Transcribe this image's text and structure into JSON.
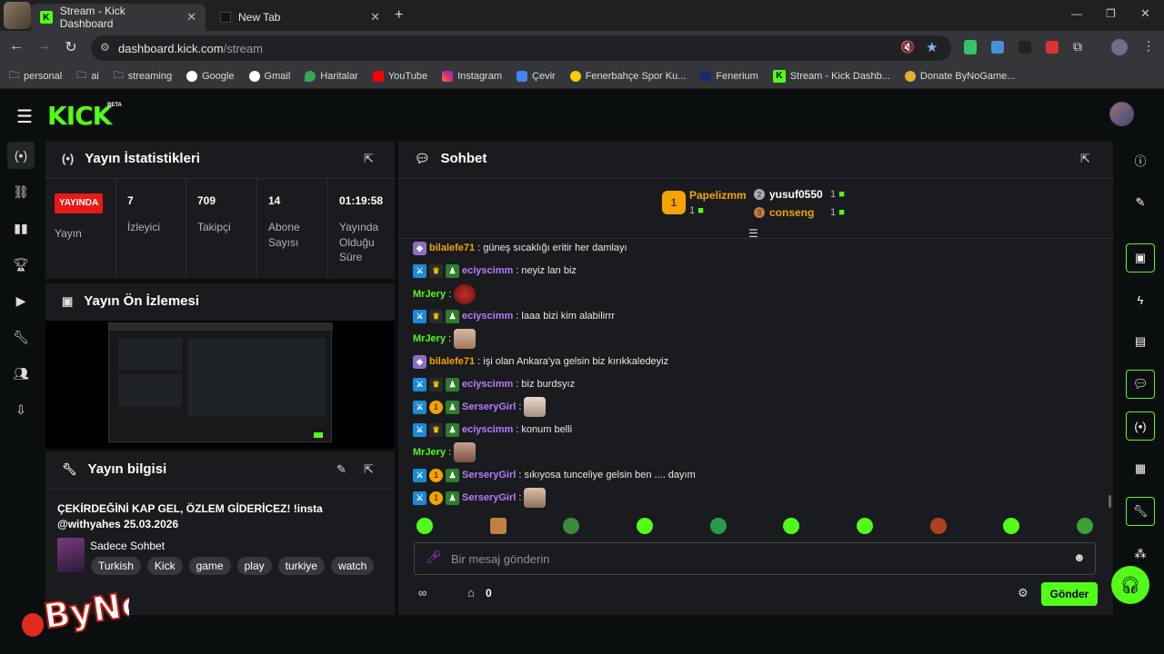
{
  "browser": {
    "tabs": [
      {
        "title": "Stream - Kick Dashboard"
      },
      {
        "title": "New Tab"
      }
    ],
    "url_host": "dashboard.kick.com",
    "url_path": "/stream",
    "bookmarks": [
      {
        "label": "personal"
      },
      {
        "label": "ai"
      },
      {
        "label": "streaming"
      },
      {
        "label": "Google"
      },
      {
        "label": "Gmail"
      },
      {
        "label": "Haritalar"
      },
      {
        "label": "YouTube"
      },
      {
        "label": "Instagram"
      },
      {
        "label": "Çevir"
      },
      {
        "label": "Fenerbahçe Spor Ku..."
      },
      {
        "label": "Fenerium"
      },
      {
        "label": "Stream - Kick Dashb..."
      },
      {
        "label": "Donate ByNoGame..."
      }
    ]
  },
  "header": {
    "logo": "KICK",
    "beta": "BETA"
  },
  "stats": {
    "title": "Yayın İstatistikleri",
    "live_badge": "YAYINDA",
    "cols": [
      {
        "value": "",
        "label": "Yayın"
      },
      {
        "value": "7",
        "label": "İzleyici"
      },
      {
        "value": "709",
        "label": "Takipçi"
      },
      {
        "value": "14",
        "label": "Abone Sayısı"
      },
      {
        "value": "01:19:58",
        "label": "Yayında Olduğu Süre"
      }
    ]
  },
  "preview": {
    "title": "Yayın Ön İzlemesi"
  },
  "info": {
    "title": "Yayın bilgisi",
    "stream_title": "ÇEKİRDEĞİNİ KAP GEL, ÖZLEM GİDERİCEZ! !insta @withyahes 25.03.2026",
    "category": "Sadece Sohbet",
    "tags": [
      "Turkish",
      "Kick",
      "game",
      "play",
      "turkiye",
      "watch"
    ]
  },
  "chat": {
    "title": "Sohbet",
    "leaderboard": {
      "first": {
        "rank": "1",
        "name": "Papelizmm",
        "count": "1"
      },
      "second": {
        "rank": "2",
        "name": "yusuf0550",
        "count": "1"
      },
      "third": {
        "rank": "3",
        "name": "conseng",
        "count": "1"
      }
    },
    "messages": [
      {
        "user": "bilalefe71",
        "text": ": güneş sıcaklığı eritir her damlayı",
        "color": "#f5a300"
      },
      {
        "user": "eciyscimm",
        "text": ": neyiz lan biz",
        "color": "#b77cff"
      },
      {
        "user": "MrJery",
        "text": ":",
        "color": "#53fc18"
      },
      {
        "user": "eciyscimm",
        "text": ": laaa bizi kim alabilirrr",
        "color": "#b77cff"
      },
      {
        "user": "MrJery",
        "text": ":",
        "color": "#53fc18"
      },
      {
        "user": "bilalefe71",
        "text": ": işi olan Ankara'ya gelsin biz kırıkkaledeyiz",
        "color": "#f5a300"
      },
      {
        "user": "eciyscimm",
        "text": ": biz burdsyız",
        "color": "#b77cff"
      },
      {
        "user": "SerseryGirl",
        "text": ":",
        "color": "#b77cff"
      },
      {
        "user": "eciyscimm",
        "text": ": konum belli",
        "color": "#b77cff"
      },
      {
        "user": "MrJery",
        "text": ":",
        "color": "#53fc18"
      },
      {
        "user": "SerseryGirl",
        "text": ": sıkıyosa tunceliye gelsin ben .... dayım",
        "color": "#b77cff"
      },
      {
        "user": "SerseryGirl",
        "text": ":",
        "color": "#b77cff"
      }
    ],
    "input_placeholder": "Bir mesaj gönderin",
    "points": "0",
    "send_label": "Gönder"
  },
  "colors": {
    "accent": "#53fc18",
    "live": "#e91916",
    "panel": "#191b1f"
  }
}
